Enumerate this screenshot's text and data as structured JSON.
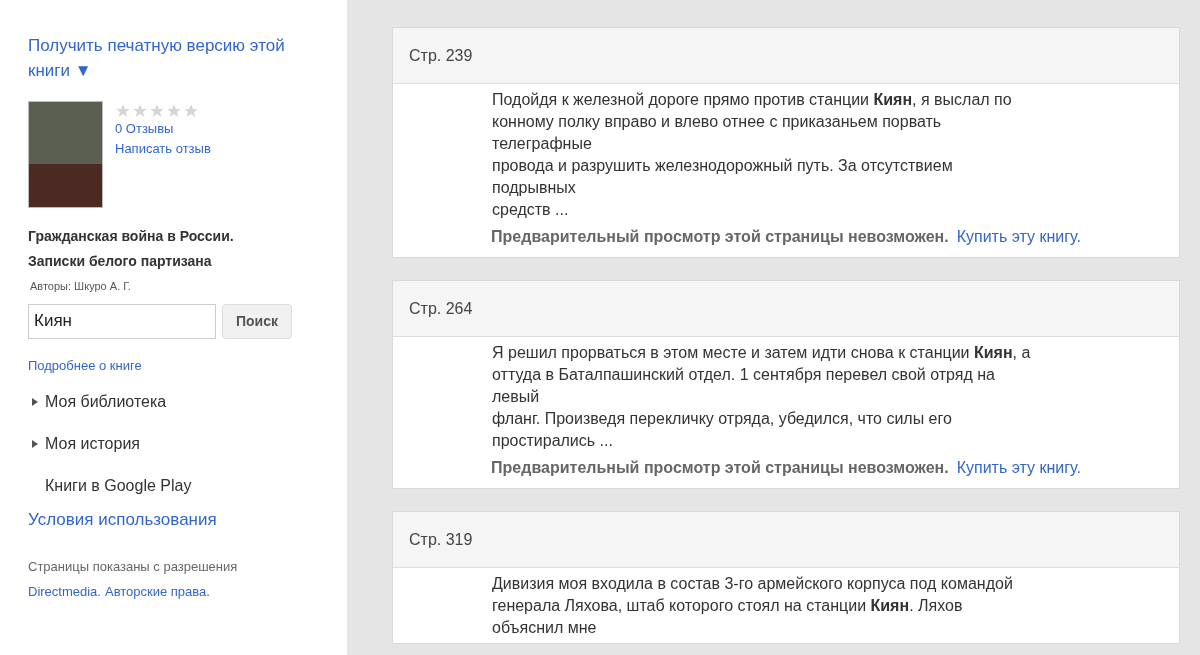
{
  "sidebar": {
    "print_link": "Получить печатную версию этой книги",
    "print_caret": "▼",
    "rating": {
      "stars": 0
    },
    "reviews_link": "0 Отзывы",
    "write_review_link": "Написать отзыв",
    "book_title": "Гражданская война в России. Записки белого партизана",
    "authors": "Авторы: Шкуро А. Г.",
    "search": {
      "value": "Киян",
      "button": "Поиск"
    },
    "about_link": "Подробнее о книге",
    "menu": [
      {
        "label": "Моя библиотека",
        "expandable": true
      },
      {
        "label": "Моя история",
        "expandable": true
      },
      {
        "label": "Книги в Google Play",
        "expandable": false
      }
    ],
    "terms_link": "Условия использования",
    "permission_text": "Страницы показаны с разрешения",
    "publisher_link": "Directmedia.",
    "copyright_link": "Авторские права."
  },
  "results": [
    {
      "page": "Стр. 239",
      "lines": [
        "Подойдя к железной дороге прямо против станции **Киян**, я выслал по",
        "конному полку вправо и влево отнее с приказаньем порвать",
        "телеграфные",
        "провода и разрушить железнодорожный путь. За отсутствием",
        "подрывных",
        "средств ..."
      ],
      "notice": "Предварительный просмотр этой страницы невозможен.",
      "buy_link": "Купить эту книгу."
    },
    {
      "page": "Стр. 264",
      "lines": [
        "Я решил прорваться в этом месте и затем идти снова к станции **Киян**, а",
        "оттуда в Баталпашинский отдел. 1 сентября перевел свой отряд на",
        "левый",
        "фланг. Произведя перекличку отряда, убедился, что силы его",
        "простирались ..."
      ],
      "notice": "Предварительный просмотр этой страницы невозможен.",
      "buy_link": "Купить эту книгу."
    },
    {
      "page": "Стр. 319",
      "lines": [
        "Дивизия моя входила в состав 3-го армейского корпуса под командой",
        "генерала Ляхова, штаб которого стоял на станции **Киян**. Ляхов",
        "объяснил мне"
      ]
    }
  ]
}
